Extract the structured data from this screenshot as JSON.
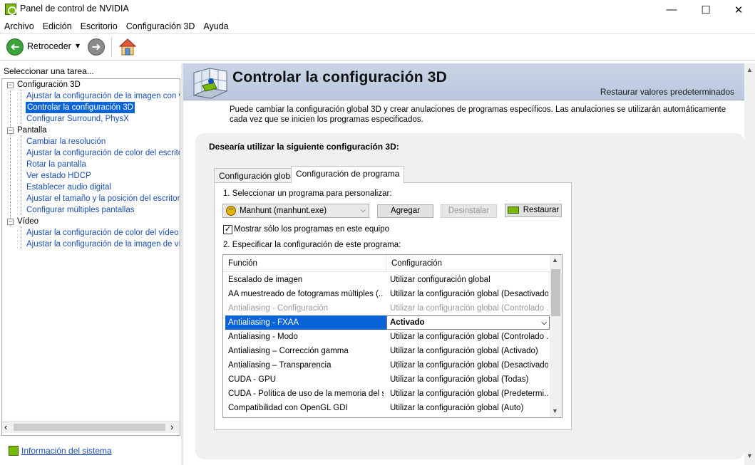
{
  "window": {
    "title": "Panel de control de NVIDIA",
    "minimize": "—",
    "maximize": "☐",
    "close": "✕"
  },
  "menu": [
    "Archivo",
    "Edición",
    "Escritorio",
    "Configuración 3D",
    "Ayuda"
  ],
  "toolbar": {
    "back_label": "Retroceder",
    "back_dropdown": "▾",
    "forward_arrow": "➜",
    "back_arrow": "➜"
  },
  "left_pane": {
    "label": "Seleccionar una tarea...",
    "tree": [
      {
        "type": "group",
        "label": "Configuración 3D",
        "expander": "−"
      },
      {
        "type": "item",
        "label": "Ajustar la configuración de la imagen con vista previa"
      },
      {
        "type": "item",
        "label": "Controlar la configuración 3D",
        "selected": true
      },
      {
        "type": "item",
        "label": "Configurar Surround, PhysX"
      },
      {
        "type": "group",
        "label": "Pantalla",
        "expander": "−"
      },
      {
        "type": "item",
        "label": "Cambiar la resolución"
      },
      {
        "type": "item",
        "label": "Ajustar la configuración de color del escritorio"
      },
      {
        "type": "item",
        "label": "Rotar la pantalla"
      },
      {
        "type": "item",
        "label": "Ver estado HDCP"
      },
      {
        "type": "item",
        "label": "Establecer audio digital"
      },
      {
        "type": "item",
        "label": "Ajustar el tamaño y la posición del escritorio"
      },
      {
        "type": "item",
        "label": "Configurar múltiples pantallas"
      },
      {
        "type": "group",
        "label": "Vídeo",
        "expander": "−"
      },
      {
        "type": "item",
        "label": "Ajustar la configuración de color del vídeo"
      },
      {
        "type": "item",
        "label": "Ajustar la configuración de la imagen de vídeo"
      }
    ],
    "scroll_left": "‹",
    "scroll_right": "›",
    "system_info": "Información del sistema"
  },
  "header": {
    "title": "Controlar la configuración 3D",
    "restore_defaults": "Restaurar valores predeterminados"
  },
  "description": "Puede cambiar la configuración global 3D y crear anulaciones de programas específicos. Las anulaciones se utilizarán automáticamente cada vez que se inicien los programas especificados.",
  "panel": {
    "heading": "Desearía utilizar la siguiente configuración 3D:",
    "tabs": [
      "Configuración global",
      "Configuración de programa"
    ],
    "active_tab": "Configuración de programa",
    "step1": "1. Seleccionar un programa para personalizar:",
    "program_selected": "Manhunt (manhunt.exe)",
    "add_button": "Agregar",
    "uninstall_button": "Desinstalar",
    "restore_button": "Restaurar",
    "checkbox_label": "Mostrar sólo los programas en este equipo",
    "checkbox_checked": true,
    "checkbox_glyph": "✓",
    "step2": "2. Especificar la configuración de este programa:",
    "grid": {
      "headers": [
        "Función",
        "Configuración"
      ],
      "rows": [
        {
          "feature": "Escalado de imagen",
          "setting": "Utilizar configuración global"
        },
        {
          "feature": "AA muestreado de fotogramas múltiples (...",
          "setting": "Utilizar la configuración global (Desactivado)"
        },
        {
          "feature": "Antialiasing - Configuración",
          "setting": "Utilizar la configuración global (Controlado ...",
          "dim": true
        },
        {
          "feature": "Antialiasing - FXAA",
          "setting": "Activado",
          "selected": true
        },
        {
          "feature": "Antialiasing - Modo",
          "setting": "Utilizar la configuración global (Controlado ..."
        },
        {
          "feature": "Antialiasing – Corrección gamma",
          "setting": "Utilizar la configuración global (Activado)"
        },
        {
          "feature": "Antialiasing – Transparencia",
          "setting": "Utilizar la configuración global (Desactivado)"
        },
        {
          "feature": "CUDA - GPU",
          "setting": "Utilizar la configuración global (Todas)"
        },
        {
          "feature": "CUDA - Política de uso de la memoria del si...",
          "setting": "Utilizar la configuración global (Predetermi..."
        },
        {
          "feature": "Compatibilidad con OpenGL GDI",
          "setting": "Utilizar la configuración global (Auto)"
        }
      ]
    }
  },
  "colors": {
    "nvidia_green": "#76b900",
    "selection_blue": "#0a64d8",
    "link_blue": "#1a4fb4",
    "header_gradient_top": "#cad5e6"
  },
  "icons": {
    "app": "nvidia-logo-icon",
    "back": "back-arrow-icon",
    "forward": "forward-arrow-icon",
    "home": "home-icon",
    "program": "manhunt-smiley-icon",
    "header": "3d-settings-cube-icon"
  }
}
